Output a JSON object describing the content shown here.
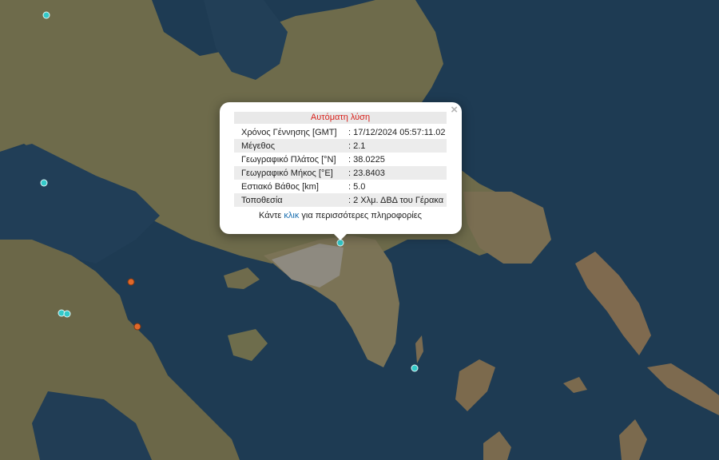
{
  "map": {
    "markers": [
      {
        "id": "m1",
        "color": "cyan"
      },
      {
        "id": "m2",
        "color": "cyan"
      },
      {
        "id": "m3",
        "color": "cyan"
      },
      {
        "id": "m4",
        "color": "cyan"
      },
      {
        "id": "m5",
        "color": "orange"
      },
      {
        "id": "m6",
        "color": "orange"
      },
      {
        "id": "m7",
        "color": "cyan"
      },
      {
        "id": "m8",
        "color": "cyan",
        "selected": true
      }
    ],
    "colors": {
      "sea": "#1d3a52",
      "land": "#6b6a4a",
      "marker_cyan": "#33c9c9",
      "marker_orange": "#e0682a"
    }
  },
  "popup": {
    "title": "Αυτόματη λύση",
    "close_glyph": "×",
    "rows": [
      {
        "label": "Χρόνος Γέννησης [GMT]",
        "value": ": 17/12/2024 05:57:11.02"
      },
      {
        "label": "Μέγεθος",
        "value": ": 2.1"
      },
      {
        "label": "Γεωγραφικό Πλάτος [°N]",
        "value": ": 38.0225"
      },
      {
        "label": "Γεωγραφικό Μήκος [°E]",
        "value": ": 23.8403"
      },
      {
        "label": "Εστιακό Βάθος [km]",
        "value": ": 5.0"
      },
      {
        "label": "Τοποθεσία",
        "value": ": 2 Χλμ. ΔΒΔ του Γέρακα"
      }
    ],
    "footer_prefix": "Κάντε ",
    "footer_link": "κλικ",
    "footer_suffix": " για περισσότερες πληροφορίες"
  }
}
